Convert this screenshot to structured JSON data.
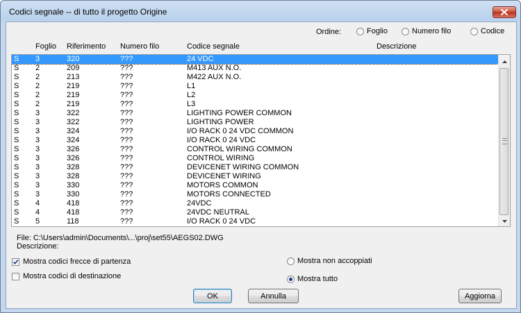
{
  "window": {
    "title": "Codici segnale -- di tutto il progetto Origine"
  },
  "ordine": {
    "label": "Ordine:",
    "options": [
      "Foglio",
      "Numero filo",
      "Codice"
    ]
  },
  "columns": [
    "Foglio",
    "Riferimento",
    "Numero filo",
    "Codice segnale",
    "Descrizione"
  ],
  "rows": [
    [
      "S",
      "3",
      "320",
      "???",
      "24 VDC"
    ],
    [
      "S",
      "2",
      "209",
      "???",
      "M413 AUX N.O."
    ],
    [
      "S",
      "2",
      "213",
      "???",
      "M422 AUX N.O."
    ],
    [
      "S",
      "2",
      "219",
      "???",
      "L1"
    ],
    [
      "S",
      "2",
      "219",
      "???",
      "L2"
    ],
    [
      "S",
      "2",
      "219",
      "???",
      "L3"
    ],
    [
      "S",
      "3",
      "322",
      "???",
      "LIGHTING POWER COMMON"
    ],
    [
      "S",
      "3",
      "322",
      "???",
      "LIGHTING POWER"
    ],
    [
      "S",
      "3",
      "324",
      "???",
      "I/O RACK 0 24 VDC COMMON"
    ],
    [
      "S",
      "3",
      "324",
      "???",
      "I/O RACK 0 24 VDC"
    ],
    [
      "S",
      "3",
      "326",
      "???",
      "CONTROL WIRING COMMON"
    ],
    [
      "S",
      "3",
      "326",
      "???",
      "CONTROL WIRING"
    ],
    [
      "S",
      "3",
      "328",
      "???",
      "DEVICENET WIRING COMMON"
    ],
    [
      "S",
      "3",
      "328",
      "???",
      "DEVICENET WIRING"
    ],
    [
      "S",
      "3",
      "330",
      "???",
      "MOTORS COMMON"
    ],
    [
      "S",
      "3",
      "330",
      "???",
      "MOTORS CONNECTED"
    ],
    [
      "S",
      "4",
      "418",
      "???",
      "24VDC"
    ],
    [
      "S",
      "4",
      "418",
      "???",
      "24VDC NEUTRAL"
    ],
    [
      "S",
      "5",
      "118",
      "???",
      "I/O RACK 0 24 VDC"
    ]
  ],
  "selected_row": 0,
  "file": "File: C:\\Users\\admin\\Documents\\...\\proj\\set55\\AEGS02.DWG",
  "descrizione": "Descrizione:",
  "options": {
    "check_frecce": {
      "label": "Mostra codici frecce di partenza",
      "checked": true
    },
    "check_dest": {
      "label": "Mostra codici di destinazione",
      "checked": false
    },
    "radio_non_accoppiati": {
      "label": "Mostra non accoppiati",
      "selected": false
    },
    "radio_tutto": {
      "label": "Mostra tutto",
      "selected": true
    }
  },
  "buttons": {
    "ok": "OK",
    "annulla": "Annulla",
    "aggiorna": "Aggiorna"
  },
  "icons": {
    "close": "close-icon",
    "scroll_up": "scroll-up-arrow-icon",
    "scroll_down": "scroll-down-arrow-icon",
    "checkmark": "checkmark-icon"
  },
  "colors": {
    "selection": "#3399ff",
    "close_button": "#c94a35"
  }
}
